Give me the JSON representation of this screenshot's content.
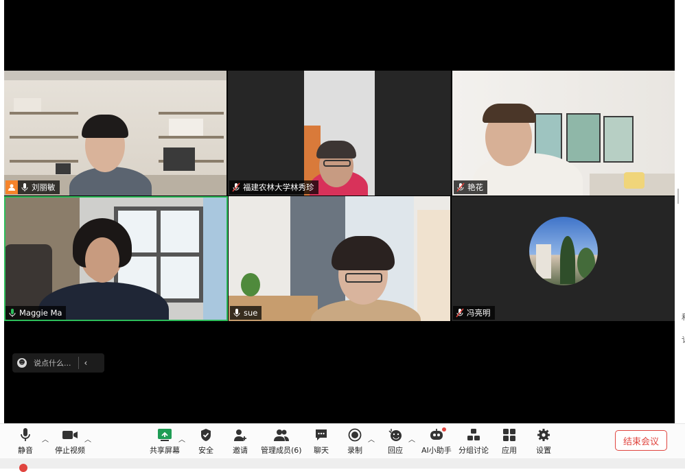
{
  "participants": [
    {
      "name": "刘丽敏",
      "host": true,
      "mic": "on"
    },
    {
      "name": "福建农林大学林秀珍",
      "host": false,
      "mic": "muted"
    },
    {
      "name": "艳花",
      "host": false,
      "mic": "muted"
    },
    {
      "name": "Maggie Ma",
      "host": false,
      "mic": "speaking",
      "active_speaker": true
    },
    {
      "name": "sue",
      "host": false,
      "mic": "on"
    },
    {
      "name": "冯亮明",
      "host": false,
      "mic": "muted",
      "video": "off"
    }
  ],
  "chat": {
    "placeholder": "说点什么...",
    "collapse_icon": "chevron-left-icon"
  },
  "toolbar": {
    "mute": "静音",
    "stop_video": "停止视频",
    "share_screen": "共享屏幕",
    "security": "安全",
    "invite": "邀请",
    "participants": "管理成员(6)",
    "chat": "聊天",
    "record": "录制",
    "reactions": "回应",
    "ai_assistant": "AI小助手",
    "breakout": "分组讨论",
    "apps": "应用",
    "settings": "设置",
    "end_meeting": "结束会议"
  },
  "edge_text": [
    "和",
    "讠"
  ],
  "colors": {
    "active_speaker_border": "#2dbd5a",
    "host_badge": "#f6832a",
    "end_button": "#e0443e",
    "muted_mic": "#e0443e"
  }
}
